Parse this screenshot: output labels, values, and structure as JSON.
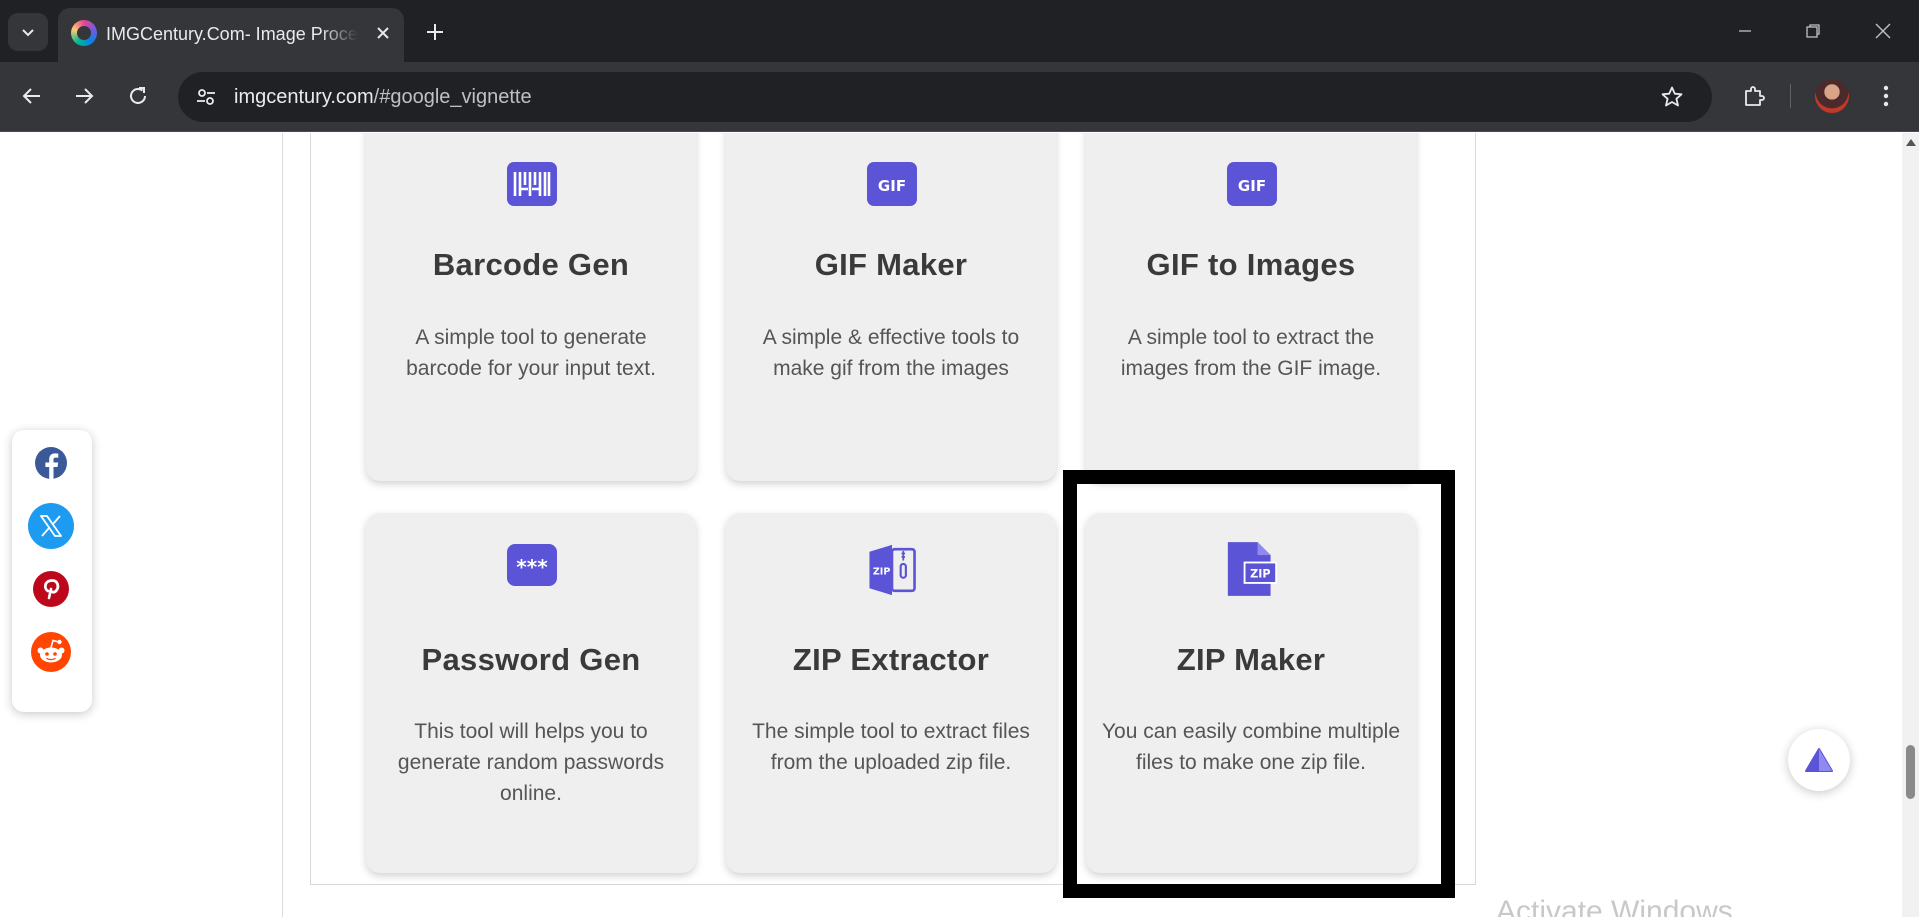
{
  "browser": {
    "tab_title": "IMGCentury.Com- Image Processing Tools",
    "url_domain": "imgcentury.com",
    "url_path": "/#google_vignette"
  },
  "icons": {
    "tab_search": "chevron-down-icon",
    "tab_close": "close-icon",
    "new_tab": "plus-icon",
    "back": "arrow-left-icon",
    "forward": "arrow-right-icon",
    "reload": "reload-icon",
    "site_info": "tune-icon",
    "bookmark": "star-icon",
    "extensions": "puzzle-icon",
    "menu": "more-vert-icon"
  },
  "colors": {
    "accent": "#5b54d6",
    "card_bg": "#efefef",
    "facebook": "#3b5998",
    "x": "#1d9bf0",
    "pinterest": "#bd081c",
    "reddit": "#ff4500"
  },
  "tools": [
    {
      "icon": "barcode-icon",
      "icon_text": "",
      "title": "Barcode Gen",
      "description": "A simple tool to generate barcode for your input text."
    },
    {
      "icon": "gif-icon",
      "icon_text": "GIF",
      "title": "GIF Maker",
      "description": "A simple & effective tools to make gif from the images"
    },
    {
      "icon": "gif-icon",
      "icon_text": "GIF",
      "title": "GIF to Images",
      "description": "A simple tool to extract the images from the GIF image."
    },
    {
      "icon": "password-icon",
      "icon_text": "***",
      "title": "Password Gen",
      "description": "This tool will helps you to generate random passwords online."
    },
    {
      "icon": "zip-archive-icon",
      "icon_text": "ZIP",
      "title": "ZIP Extractor",
      "description": "The simple tool to extract files from the uploaded zip file."
    },
    {
      "icon": "zip-file-icon",
      "icon_text": "ZIP",
      "title": "ZIP Maker",
      "description": "You can easily combine multiple files to make one zip file."
    }
  ],
  "share": [
    "facebook-icon",
    "x-icon",
    "pinterest-icon",
    "reddit-icon"
  ],
  "watermark": "Activate Windows"
}
